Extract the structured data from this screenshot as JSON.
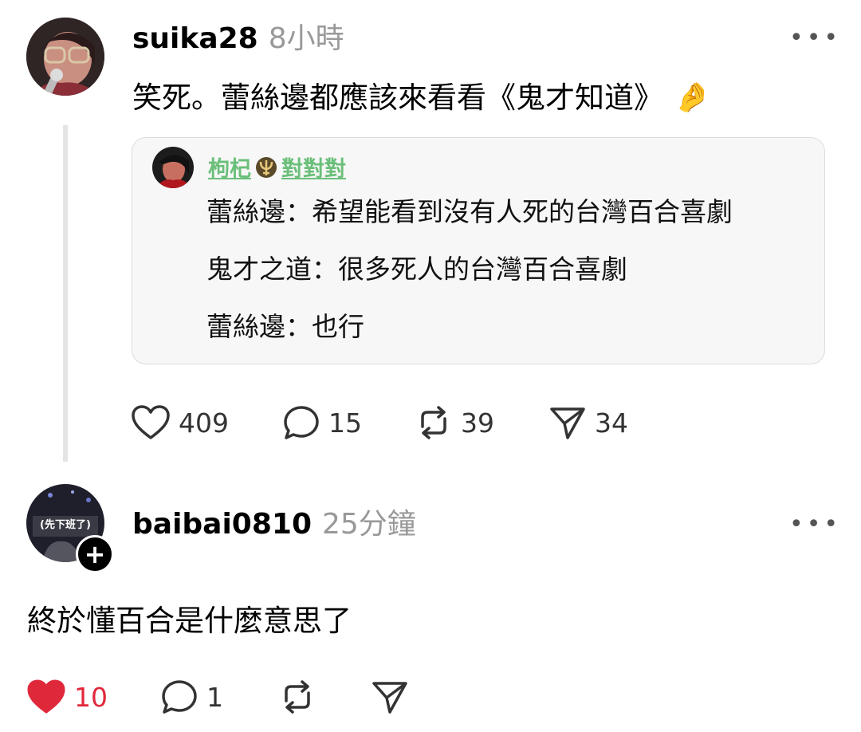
{
  "post": {
    "username": "suika28",
    "time": "8小時",
    "text": "笑死。蕾絲邊都應該來看看《鬼才知道》",
    "emoji": "🤌",
    "quote": {
      "username": "枸杞",
      "username_suffix": "對對對",
      "lines": [
        "蕾絲邊：希望能看到沒有人死的台灣百合喜劇",
        "鬼才之道：很多死人的台灣百合喜劇",
        "蕾絲邊：也行"
      ]
    },
    "actions": {
      "likes": "409",
      "comments": "15",
      "reposts": "39",
      "shares": "34"
    }
  },
  "reply": {
    "username": "baibai0810",
    "time": "25分鐘",
    "avatar_caption": "(先下班了)",
    "text": "終於懂百合是什麼意思了",
    "actions": {
      "likes": "10",
      "comments": "1",
      "liked": true
    }
  },
  "icons": {
    "more": "more-dots-icon",
    "like": "heart-icon",
    "comment": "comment-bubble-icon",
    "repost": "repost-icon",
    "share": "send-icon",
    "follow": "plus-icon"
  },
  "colors": {
    "liked": "#e0283b",
    "quote_user": "#6bbf7a",
    "muted": "#999999"
  }
}
